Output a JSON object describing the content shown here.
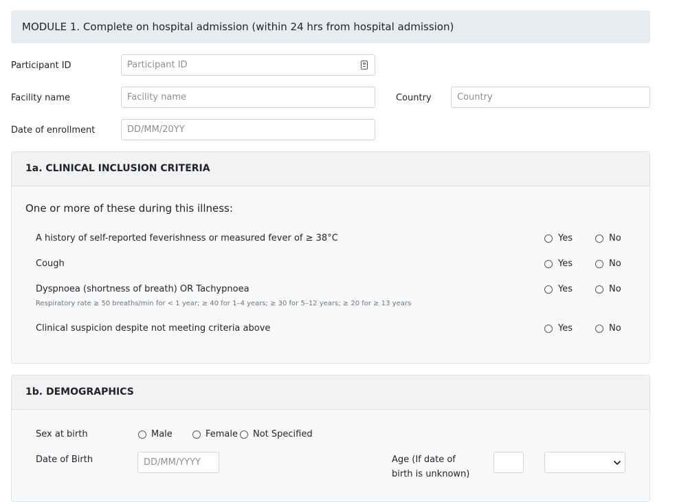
{
  "module": {
    "title": "MODULE 1. Complete on hospital admission (within 24 hrs from hospital admission)"
  },
  "participant": {
    "label": "Participant ID",
    "placeholder": "Participant ID",
    "icon": "id-card-icon"
  },
  "facility": {
    "label": "Facility name",
    "placeholder": "Facility name"
  },
  "country": {
    "label": "Country",
    "placeholder": "Country"
  },
  "enrollment": {
    "label": "Date of enrollment",
    "placeholder": "DD/MM/20YY"
  },
  "inclusion": {
    "title": "1a. CLINICAL INCLUSION CRITERIA",
    "intro": "One or more of these during this illness:",
    "yes_label": "Yes",
    "no_label": "No",
    "criteria": [
      {
        "label": "A history of self-reported feverishness or measured fever of ≥ 38°C",
        "hint": ""
      },
      {
        "label": "Cough",
        "hint": ""
      },
      {
        "label": "Dyspnoea (shortness of breath) OR Tachypnoea",
        "hint": "Respiratory rate ≥ 50 breaths/min for < 1 year; ≥ 40 for 1–4 years; ≥ 30 for 5–12 years; ≥ 20 for ≥ 13 years"
      },
      {
        "label": "Clinical suspicion despite not meeting criteria above",
        "hint": ""
      }
    ]
  },
  "demographics": {
    "title": "1b. DEMOGRAPHICS",
    "sex": {
      "label": "Sex at birth",
      "options": [
        "Male",
        "Female",
        "Not Specified"
      ]
    },
    "dob": {
      "label": "Date of Birth",
      "placeholder": "DD/MM/YYYY"
    },
    "age": {
      "label_line1": "Age (If date of",
      "label_line2": "birth is unknown)",
      "value": "",
      "unit_selected": ""
    }
  }
}
